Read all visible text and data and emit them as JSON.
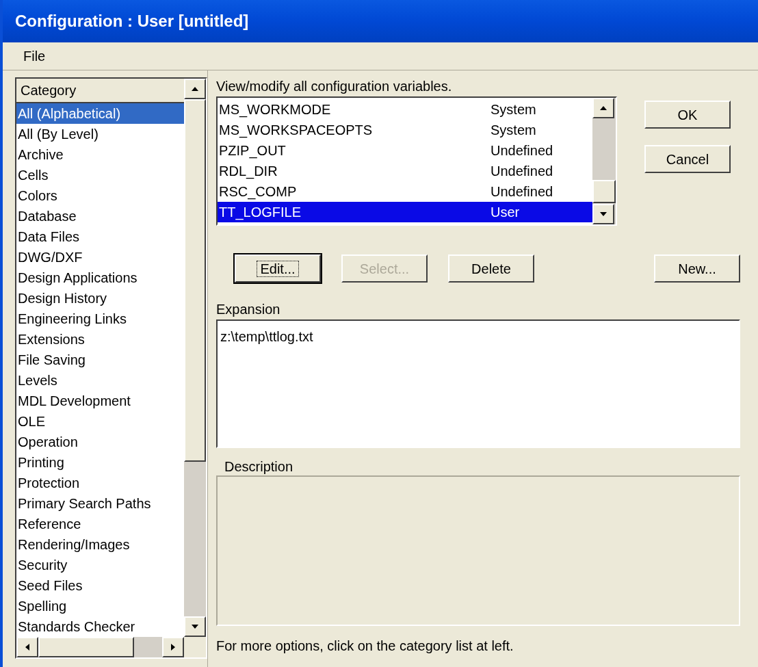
{
  "window": {
    "title": "Configuration : User [untitled]"
  },
  "menu": [
    {
      "label": "File"
    }
  ],
  "category_list": {
    "header": "Category",
    "items": [
      {
        "label": "All (Alphabetical)",
        "selected": true
      },
      {
        "label": "All (By Level)",
        "selected": false
      },
      {
        "label": "Archive",
        "selected": false
      },
      {
        "label": "Cells",
        "selected": false
      },
      {
        "label": "Colors",
        "selected": false
      },
      {
        "label": "Database",
        "selected": false
      },
      {
        "label": "Data Files",
        "selected": false
      },
      {
        "label": "DWG/DXF",
        "selected": false
      },
      {
        "label": "Design Applications",
        "selected": false
      },
      {
        "label": "Design History",
        "selected": false
      },
      {
        "label": "Engineering Links",
        "selected": false
      },
      {
        "label": "Extensions",
        "selected": false
      },
      {
        "label": "File Saving",
        "selected": false
      },
      {
        "label": "Levels",
        "selected": false
      },
      {
        "label": "MDL Development",
        "selected": false
      },
      {
        "label": "OLE",
        "selected": false
      },
      {
        "label": "Operation",
        "selected": false
      },
      {
        "label": "Printing",
        "selected": false
      },
      {
        "label": "Protection",
        "selected": false
      },
      {
        "label": "Primary Search Paths",
        "selected": false
      },
      {
        "label": "Reference",
        "selected": false
      },
      {
        "label": "Rendering/Images",
        "selected": false
      },
      {
        "label": "Security",
        "selected": false
      },
      {
        "label": "Seed Files",
        "selected": false
      },
      {
        "label": "Spelling",
        "selected": false
      },
      {
        "label": "Standards Checker",
        "selected": false
      }
    ]
  },
  "variables": {
    "caption": "View/modify all configuration variables.",
    "rows": [
      {
        "name": "MS_WORKMODE",
        "level": "System",
        "selected": false
      },
      {
        "name": "MS_WORKSPACEOPTS",
        "level": "System",
        "selected": false
      },
      {
        "name": "PZIP_OUT",
        "level": "Undefined",
        "selected": false
      },
      {
        "name": "RDL_DIR",
        "level": "Undefined",
        "selected": false
      },
      {
        "name": "RSC_COMP",
        "level": "Undefined",
        "selected": false
      },
      {
        "name": "TT_LOGFILE",
        "level": "User",
        "selected": true
      }
    ]
  },
  "side_buttons": [
    {
      "label": "OK",
      "disabled": false,
      "focused": false
    },
    {
      "label": "Cancel",
      "disabled": false,
      "focused": false
    }
  ],
  "action_buttons": [
    {
      "label": "Edit...",
      "disabled": false,
      "focused": true
    },
    {
      "label": "Select...",
      "disabled": true,
      "focused": false
    },
    {
      "label": "Delete",
      "disabled": false,
      "focused": false
    }
  ],
  "new_button": {
    "label": "New...",
    "disabled": false,
    "focused": false
  },
  "expansion": {
    "label": "Expansion",
    "value": "z:\\temp\\ttlog.txt"
  },
  "description": {
    "label": "Description"
  },
  "status": "For more options, click on the category list at left."
}
